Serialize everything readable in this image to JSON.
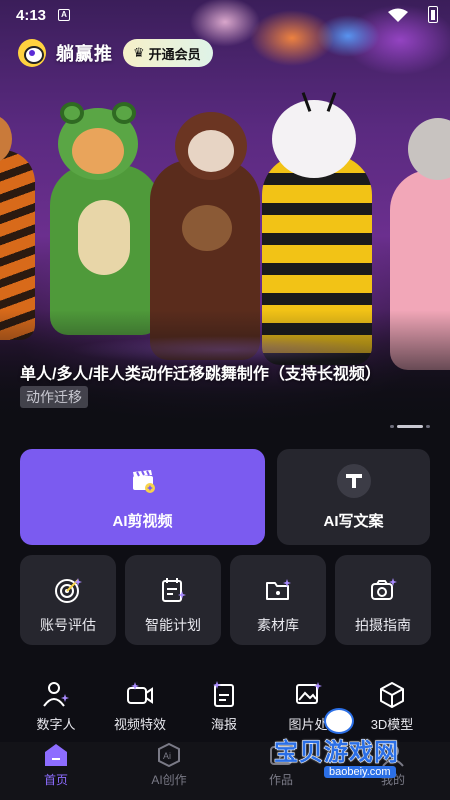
{
  "status_bar": {
    "time": "4:13",
    "notification_glyph": "A"
  },
  "header": {
    "app_name": "躺赢推",
    "vip_label": "开通会员"
  },
  "banner": {
    "title": "单人/多人/非人类动作迁移跳舞制作（支持长视频）",
    "tag": "动作迁移",
    "page_count": 3,
    "active_page": 1
  },
  "actions": {
    "primary": {
      "label": "AI剪视频",
      "icon": "clapperboard-icon"
    },
    "secondary": {
      "label": "AI写文案",
      "icon": "text-t-icon"
    }
  },
  "tools": [
    {
      "label": "账号评估",
      "icon": "target-icon"
    },
    {
      "label": "智能计划",
      "icon": "calendar-plan-icon"
    },
    {
      "label": "素材库",
      "icon": "folder-icon"
    },
    {
      "label": "拍摄指南",
      "icon": "camera-icon"
    }
  ],
  "shortcuts": [
    {
      "label": "数字人",
      "icon": "digital-human-icon"
    },
    {
      "label": "视频特效",
      "icon": "video-effect-icon"
    },
    {
      "label": "海报",
      "icon": "poster-icon"
    },
    {
      "label": "图片处",
      "icon": "image-edit-icon"
    },
    {
      "label": "3D模型",
      "icon": "cube-icon"
    }
  ],
  "nav": [
    {
      "label": "首页",
      "icon": "home-icon",
      "active": true
    },
    {
      "label": "AI创作",
      "icon": "ai-create-icon",
      "active": false
    },
    {
      "label": "作品",
      "icon": "works-icon",
      "active": false
    },
    {
      "label": "我的",
      "icon": "profile-icon",
      "active": false
    }
  ],
  "watermark": {
    "text": "宝贝游戏网",
    "url": "baobeiy.com"
  },
  "colors": {
    "accent": "#7b5bf0",
    "card": "#26262e",
    "background": "#0e0e14",
    "nav_active": "#8d6dff"
  }
}
